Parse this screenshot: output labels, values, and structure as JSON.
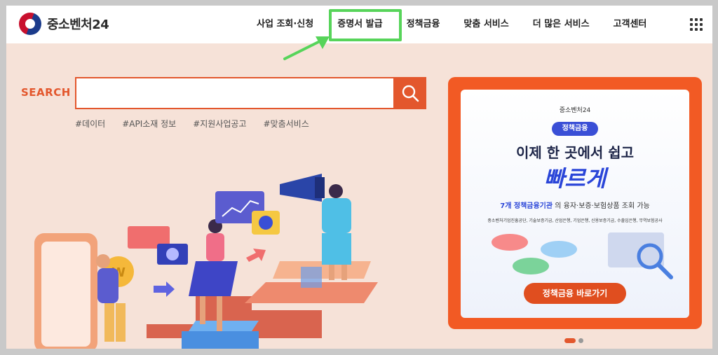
{
  "header": {
    "logo_text": "중소벤처24",
    "nav": [
      "사업 조회·신청",
      "증명서 발급",
      "정책금융",
      "맞춤 서비스",
      "더 많은 서비스",
      "고객센터"
    ]
  },
  "search": {
    "label": "SEARCH",
    "placeholder": "",
    "tags": [
      "#데이터",
      "#API소재 정보",
      "#지원사업공고",
      "#맞춤서비스"
    ]
  },
  "banner": {
    "logo_text": "중소벤처24",
    "badge": "정책금융",
    "title_line1": "이제 한 곳에서 쉽고",
    "title_line2": "빠르게",
    "subtitle_highlight": "7개 정책금융기관",
    "subtitle_rest": "의 융자·보증·보험상품 조회 가능",
    "institutions": "중소벤처기업진흥공단, 기술보증기금, 산업은행, 기업은행, 신용보증기금, 수출입은행, 무역보험공사",
    "button": "정책금융 바로가기"
  },
  "carousel": {
    "active_index": 0,
    "count": 2
  },
  "colors": {
    "accent": "#e3572d",
    "highlight": "#57d45a",
    "banner": "#f25a24",
    "background": "#f6e2d8"
  }
}
